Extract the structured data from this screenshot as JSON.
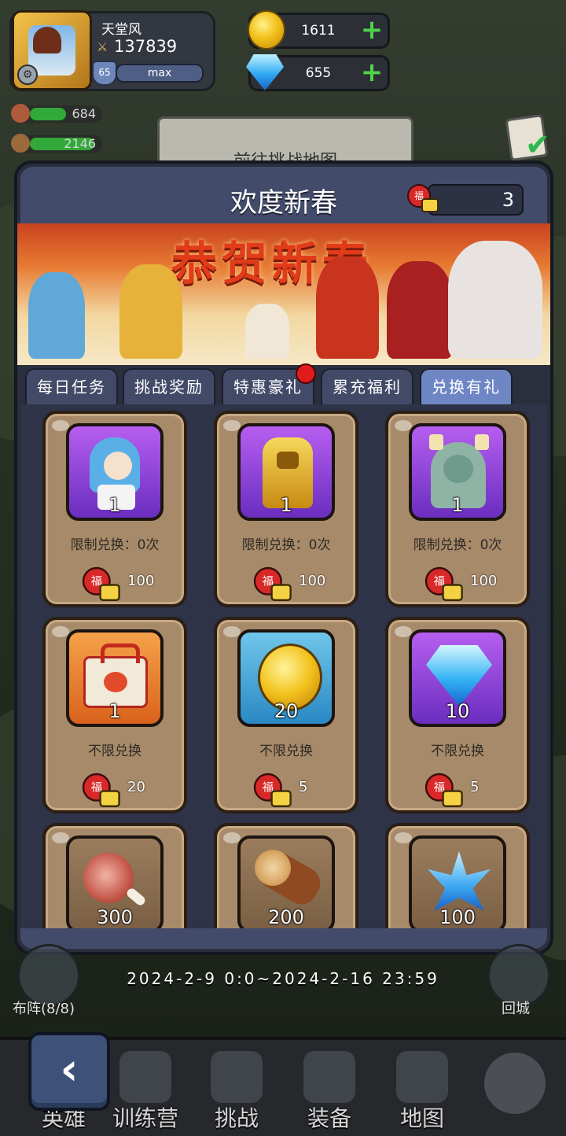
{
  "player": {
    "name": "天堂风",
    "power": "137839",
    "level": "65",
    "exp_text": "max"
  },
  "currency": {
    "gold": "1611",
    "gems": "655"
  },
  "side_resources": {
    "meat": "684",
    "wood": "2146"
  },
  "quest_card_text": "前往挑战地图",
  "modal": {
    "title": "欢度新春",
    "token_count": "3",
    "banner_title": "恭贺新春",
    "tabs": [
      {
        "label": "每日任务",
        "active": false,
        "badge": false
      },
      {
        "label": "挑战奖励",
        "active": false,
        "badge": false
      },
      {
        "label": "特惠豪礼",
        "active": false,
        "badge": true
      },
      {
        "label": "累充福利",
        "active": false,
        "badge": false
      },
      {
        "label": "兑换有礼",
        "active": true,
        "badge": false
      }
    ],
    "items": [
      {
        "icon": "nurse-hero-portrait",
        "bg": "purple",
        "qty": "1",
        "limit": "限制兑换：0次",
        "cost": "100"
      },
      {
        "icon": "golden-knight-hero-portrait",
        "bg": "purple",
        "qty": "1",
        "limit": "限制兑换：0次",
        "cost": "100"
      },
      {
        "icon": "dragon-girl-hero-portrait",
        "bg": "purple",
        "qty": "1",
        "limit": "限制兑换：0次",
        "cost": "100"
      },
      {
        "icon": "gift-box-icon",
        "bg": "orange",
        "qty": "1",
        "limit": "不限兑换",
        "cost": "20"
      },
      {
        "icon": "gold-coin-icon",
        "bg": "blue",
        "qty": "20",
        "limit": "不限兑换",
        "cost": "5"
      },
      {
        "icon": "blue-gem-icon",
        "bg": "purple",
        "qty": "10",
        "limit": "不限兑换",
        "cost": "5"
      },
      {
        "icon": "meat-icon",
        "bg": "brown",
        "qty": "300",
        "limit": "",
        "cost": ""
      },
      {
        "icon": "wood-log-icon",
        "bg": "brown",
        "qty": "200",
        "limit": "",
        "cost": ""
      },
      {
        "icon": "crystal-icon",
        "bg": "brown",
        "qty": "100",
        "limit": "",
        "cost": ""
      }
    ]
  },
  "event_date": "2024-2-9 0:0~2024-2-16 23:59",
  "side_buttons": {
    "formation": "布阵(8/8)",
    "return_city": "回城"
  },
  "nav": [
    {
      "label": "英雄",
      "icon": "hero-icon"
    },
    {
      "label": "训练营",
      "icon": "training-icon"
    },
    {
      "label": "挑战",
      "icon": "sword-icon"
    },
    {
      "label": "装备",
      "icon": "armor-icon"
    },
    {
      "label": "地图",
      "icon": "map-icon"
    },
    {
      "label": "",
      "icon": "lock-icon"
    }
  ],
  "colors": {
    "accent_tab": "#6f86c4",
    "card_bg": "#a78a6a",
    "plus_green": "#4ed34a",
    "badge_red": "#e11b1b"
  }
}
